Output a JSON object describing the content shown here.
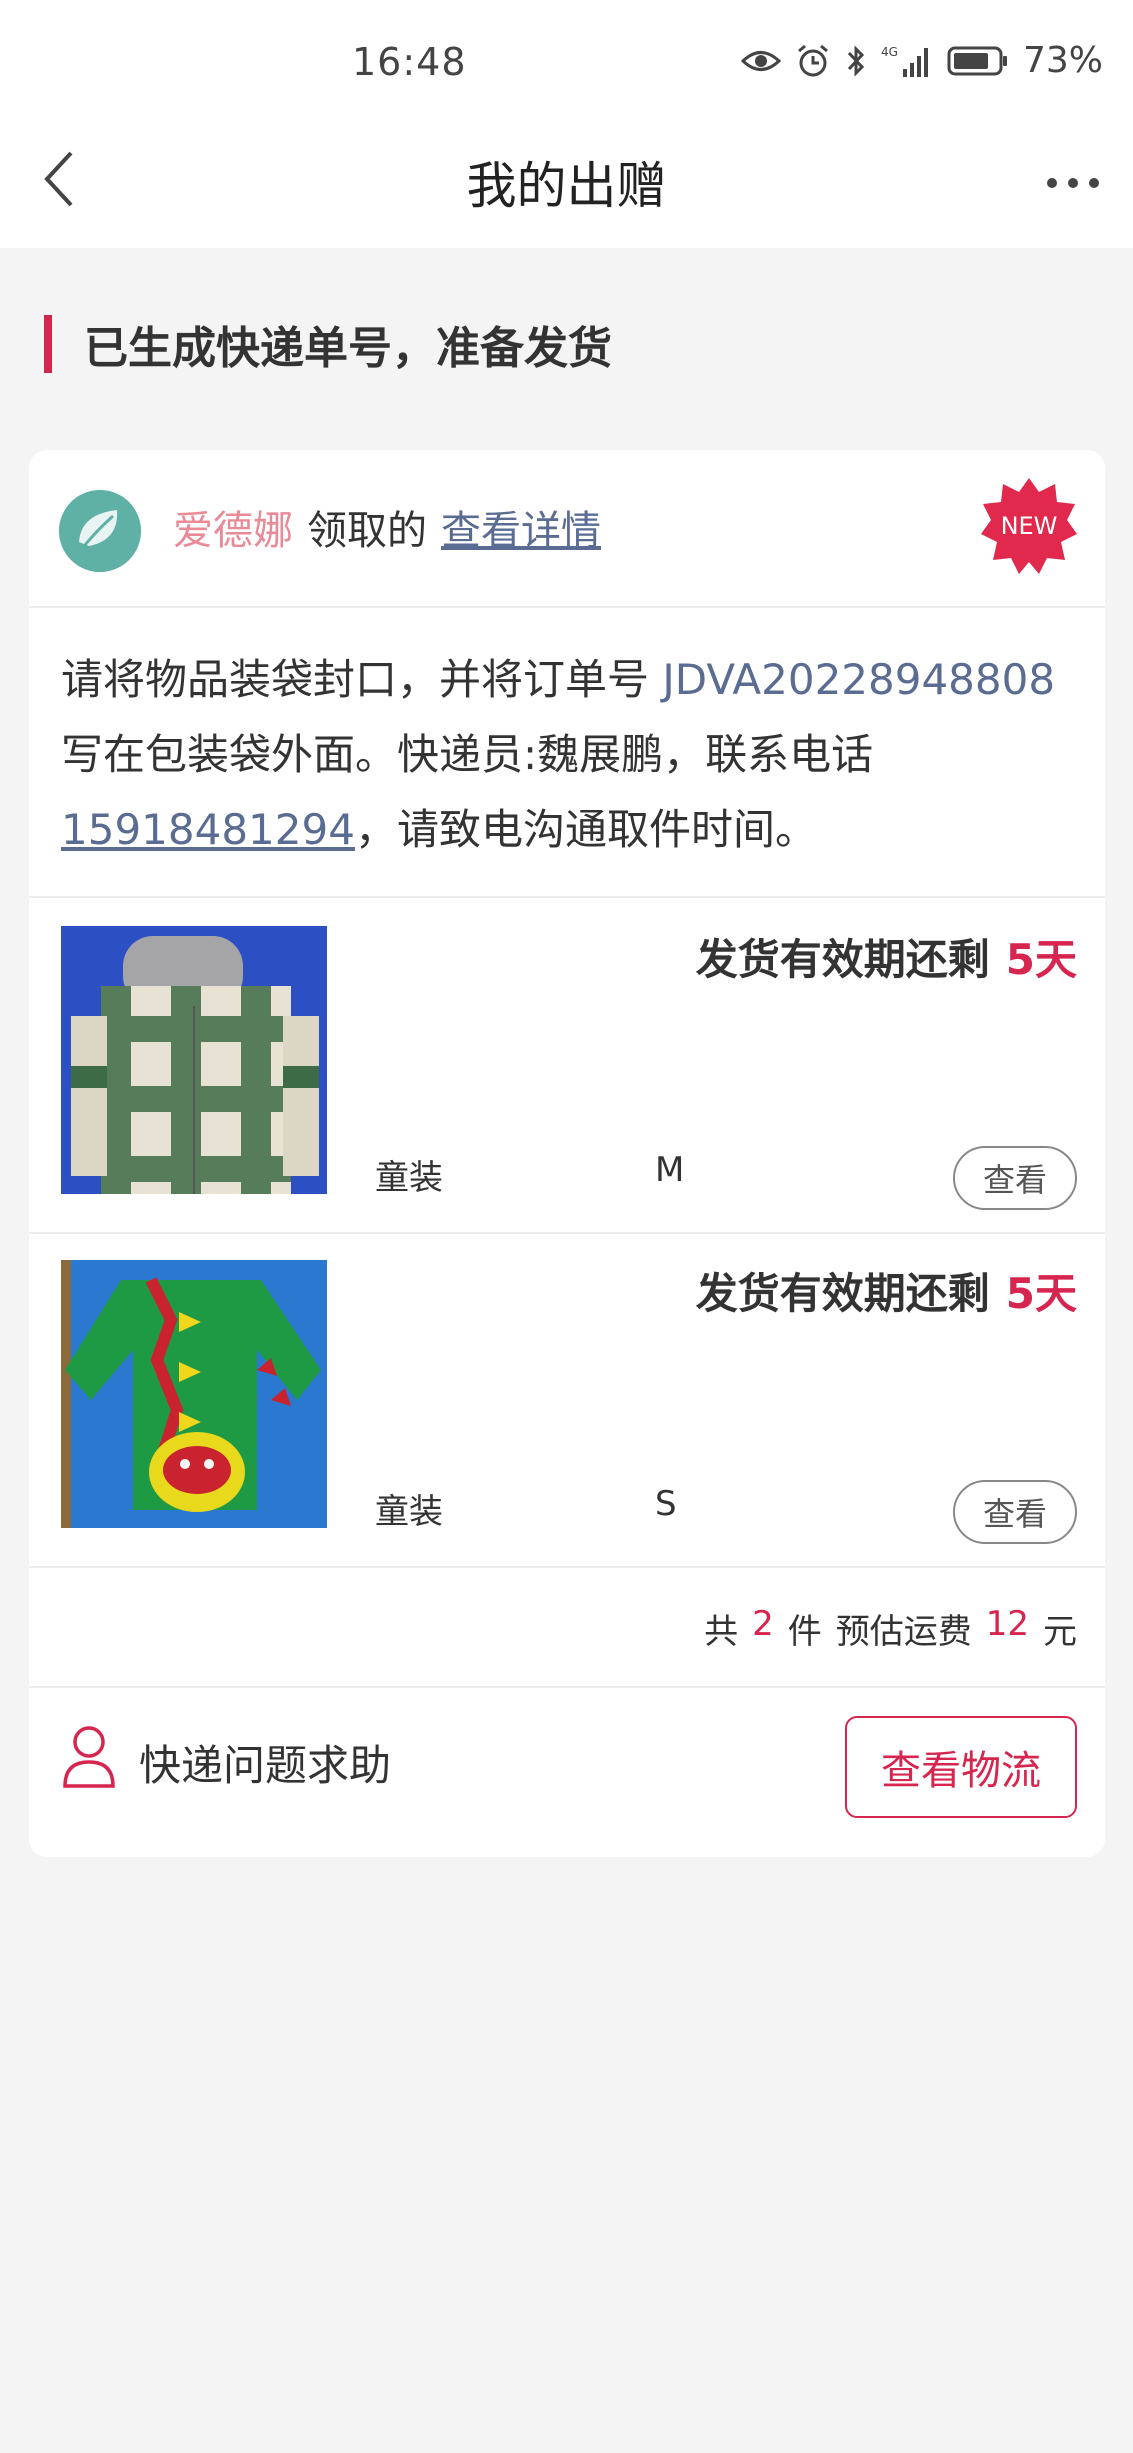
{
  "status_bar": {
    "time": "16:48",
    "network": "4G",
    "battery": "73%",
    "icons": [
      "eye-icon",
      "alarm-icon",
      "bluetooth-icon",
      "signal-icon",
      "battery-icon"
    ]
  },
  "nav": {
    "title": "我的出赠",
    "back_icon": "chevron-left-icon",
    "more_icon": "more-icon"
  },
  "section": {
    "title": "已生成快递单号，准备发货"
  },
  "card": {
    "donor": {
      "name": "爱德娜",
      "action": "领取的",
      "link": "查看详情",
      "badge": "NEW"
    },
    "info": {
      "text_before": "请将物品装袋封口，并将订单号 ",
      "order_no": "JDVA20228948808",
      "text_middle": " 写在包装袋外面。快递员:魏展鹏，联系电话",
      "phone": "15918481294",
      "text_after": "，请致电沟通取件时间。"
    },
    "items": [
      {
        "deadline_label": "发货有效期还剩",
        "deadline_days": "5天",
        "category": "童装",
        "size": "M",
        "view_label": "查看",
        "image": "plaid-hooded-shirt"
      },
      {
        "deadline_label": "发货有效期还剩",
        "deadline_days": "5天",
        "category": "童装",
        "size": "S",
        "view_label": "查看",
        "image": "green-dinosaur-hoodie"
      }
    ],
    "summary": {
      "prefix": "共",
      "count": "2",
      "count_unit": "件",
      "fee_label": "预估运费",
      "fee": "12",
      "fee_unit": "元"
    },
    "footer": {
      "help_label": "快递问题求助",
      "logistics_button": "查看物流"
    }
  },
  "colors": {
    "accent": "#d6254f",
    "link": "#5a6c92",
    "donor_name": "#e88b97",
    "background": "#f4f4f4"
  }
}
